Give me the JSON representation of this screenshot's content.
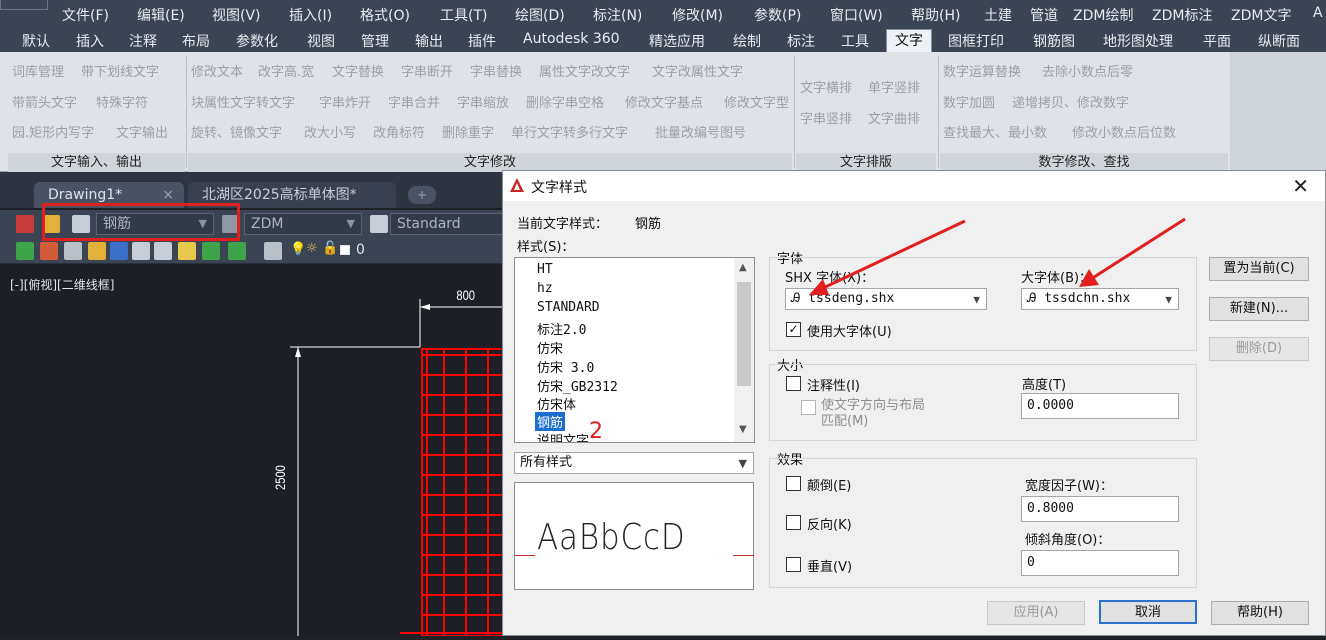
{
  "menu": {
    "items": [
      "文件(F)",
      "编辑(E)",
      "视图(V)",
      "插入(I)",
      "格式(O)",
      "工具(T)",
      "绘图(D)",
      "标注(N)",
      "修改(M)",
      "参数(P)",
      "窗口(W)",
      "帮助(H)",
      "土建",
      "管道",
      "ZDM绘制",
      "ZDM标注",
      "ZDM文字",
      "A"
    ]
  },
  "ribbon_tabs": {
    "items": [
      "默认",
      "插入",
      "注释",
      "布局",
      "参数化",
      "视图",
      "管理",
      "输出",
      "插件",
      "Autodesk 360",
      "精选应用",
      "绘制",
      "标注",
      "工具",
      "文字",
      "图框打印",
      "钢筋图",
      "地形图处理",
      "平面",
      "纵断面"
    ],
    "active": "文字"
  },
  "ribbon": {
    "group1": {
      "rows": [
        [
          "词库管理",
          "带下划线文字"
        ],
        [
          "带箭头文字",
          "特殊字符"
        ],
        [
          "园.矩形内写字",
          "文字输出"
        ]
      ],
      "title": "文字输入、输出"
    },
    "group2": {
      "rows": [
        [
          "修改文本",
          "改字高.宽",
          "文字替换",
          "字串断开",
          "字串替换",
          "属性文字改文字",
          "文字改属性文字"
        ],
        [
          "块属性文字转文字",
          "字串炸开",
          "字串合并",
          "字串缩放",
          "删除字串空格",
          "修改文字基点",
          "修改文字型"
        ],
        [
          "旋转、镜像文字",
          "改大小写",
          "改角标符",
          "删除重字",
          "单行文字转多行文字",
          "批量改编号图号"
        ]
      ],
      "title": "文字修改"
    },
    "group3": {
      "rows": [
        [
          "文字横排",
          "单字竖排"
        ],
        [
          "字串竖排",
          "文字曲排"
        ]
      ],
      "title": "文字排版"
    },
    "group4": {
      "rows": [
        [
          "数字运算替换",
          "去除小数点后零"
        ],
        [
          "数字加圆",
          "递增拷贝、修改数字"
        ],
        [
          "查找最大、最小数",
          "修改小数点后位数"
        ]
      ],
      "title": "数字修改、查找"
    }
  },
  "file_tabs": {
    "tab1": "Drawing1*",
    "tab2": "北湖区2025高标单体图*",
    "close": "×"
  },
  "toolbar": {
    "text_style": "钢筋",
    "dim_style": "ZDM",
    "table_style": "Standard",
    "layer_value": "0"
  },
  "viewport": {
    "label": "[-][俯视][二维线框]",
    "dim_top": "800",
    "dim_left": "2500"
  },
  "dialog": {
    "title": "文字样式",
    "current_style_label": "当前文字样式：",
    "current_style_value": "钢筋",
    "styles_label": "样式(S)：",
    "styles": [
      "HT",
      "hz",
      "STANDARD",
      "标注2.0",
      "仿宋",
      "仿宋 3.0",
      "仿宋_GB2312",
      "仿宋体",
      "钢筋",
      "说明文字"
    ],
    "selected_style": "钢筋",
    "filter": "所有样式",
    "preview_text": "AaBbCcD",
    "font": {
      "section": "字体",
      "shx_label": "SHX 字体(X)：",
      "shx_value": "tssdeng.shx",
      "big_label": "大字体(B)：",
      "big_value": "tssdchn.shx",
      "use_big_label": "使用大字体(U)",
      "use_big_checked": true
    },
    "size": {
      "section": "大小",
      "annotative_label": "注释性(I)",
      "match_layout_label": "使文字方向与布局\n匹配(M)",
      "height_label": "高度(T)",
      "height_value": "0.0000"
    },
    "effects": {
      "section": "效果",
      "upside_label": "颠倒(E)",
      "backwards_label": "反向(K)",
      "vertical_label": "垂直(V)",
      "width_label": "宽度因子(W)：",
      "width_value": "0.8000",
      "oblique_label": "倾斜角度(O)：",
      "oblique_value": "0"
    },
    "buttons": {
      "set_current": "置为当前(C)",
      "new": "新建(N)...",
      "delete": "删除(D)",
      "apply": "应用(A)",
      "cancel": "取消",
      "help": "帮助(H)"
    },
    "annotation_number": "2"
  },
  "colors": {
    "accent": "#1c6fd1",
    "annotation": "#e02020",
    "grid": "#ff0000"
  }
}
